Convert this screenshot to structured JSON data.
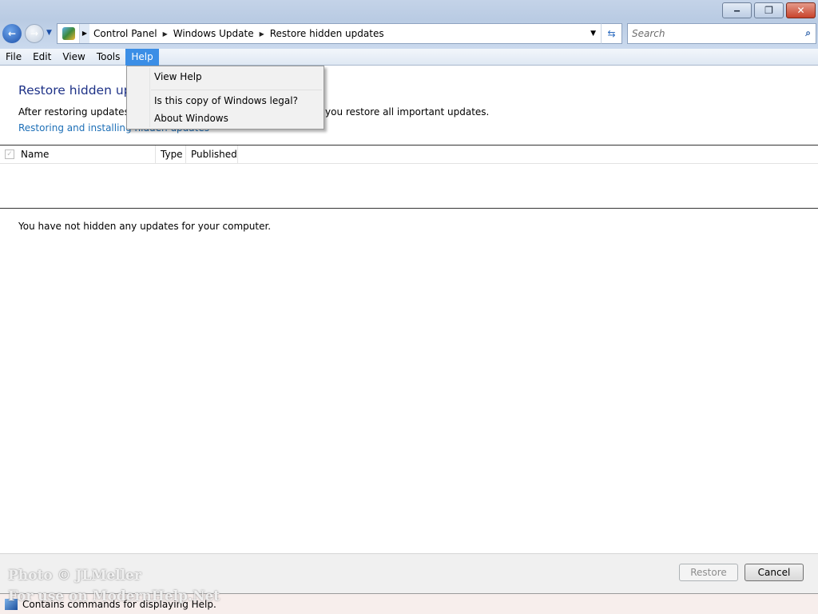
{
  "window": {
    "minimize": "‒",
    "restore": "❐",
    "close": "✕"
  },
  "address": {
    "crumbs": [
      "Control Panel",
      "Windows Update",
      "Restore hidden updates"
    ]
  },
  "search": {
    "placeholder": "Search"
  },
  "menu": [
    "File",
    "Edit",
    "View",
    "Tools",
    "Help"
  ],
  "help_menu": {
    "items": [
      "View Help",
      "Is this copy of Windows legal?",
      "About Windows"
    ]
  },
  "main": {
    "title": "Restore hidden updates",
    "desc_left": "After restoring updates, y",
    "desc_right": "you restore all important updates.",
    "link": "Restoring and installing hidden updates",
    "columns": [
      "Name",
      "Type",
      "Published"
    ],
    "empty": "You have not hidden any updates for your computer."
  },
  "buttons": {
    "restore": "Restore",
    "cancel": "Cancel"
  },
  "status": "Contains commands for displaying Help.",
  "watermark": [
    "Photo © JLMeller",
    "For use on ModernHelp.Net"
  ]
}
